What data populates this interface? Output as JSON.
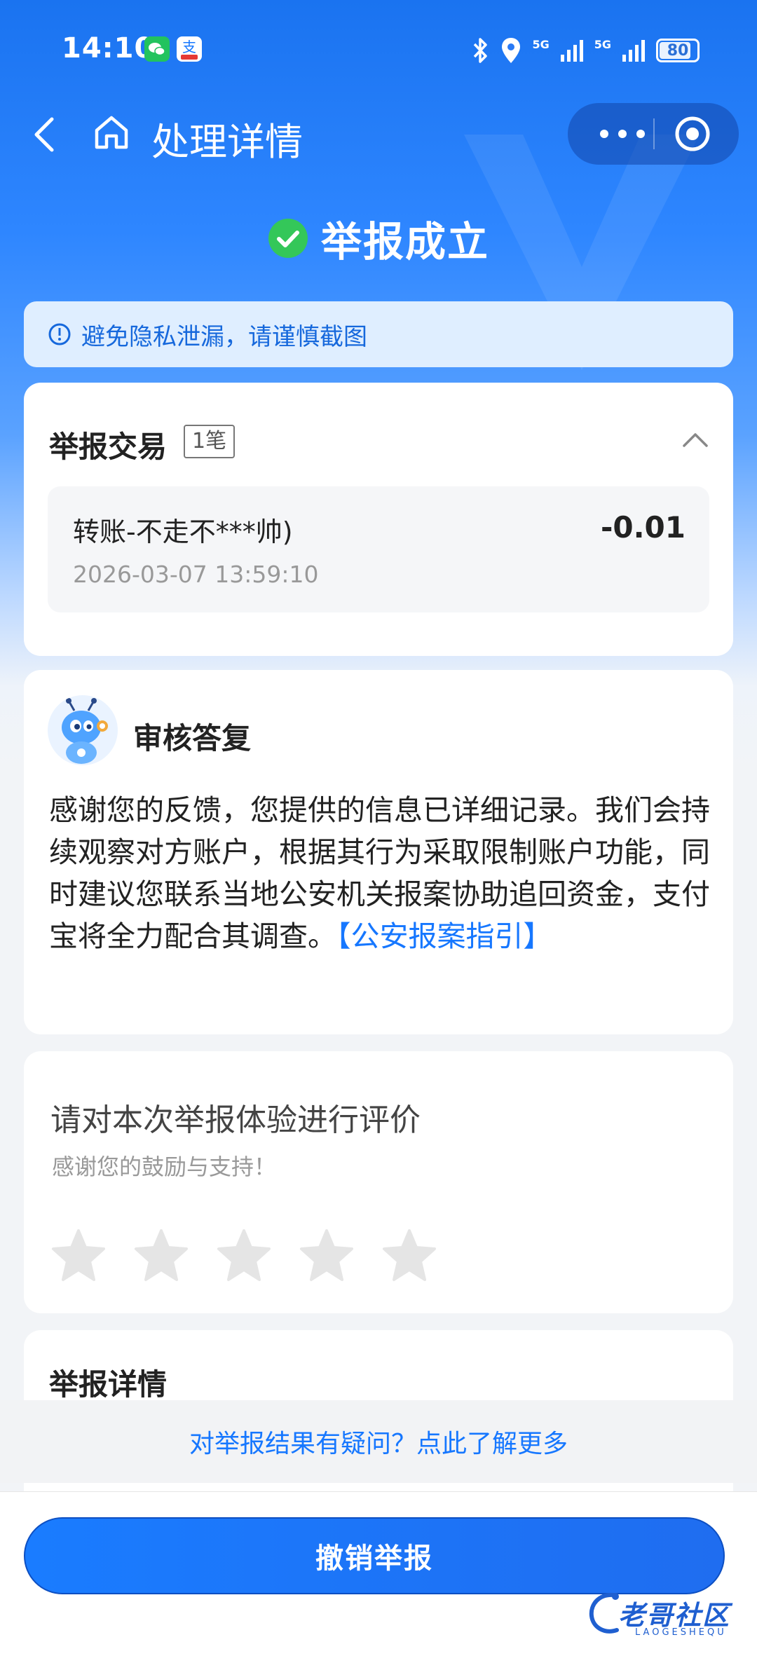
{
  "status_bar": {
    "time": "14:10",
    "network_labels": [
      "5G",
      "5G"
    ],
    "battery_level": "80"
  },
  "nav": {
    "title": "处理详情"
  },
  "result": {
    "title": "举报成立",
    "status_color": "#34c759"
  },
  "notice": {
    "text": "避免隐私泄漏，请谨慎截图"
  },
  "transaction_card": {
    "title": "举报交易",
    "count_badge": "1笔",
    "items": [
      {
        "name": "转账-不走不***帅)",
        "time": "2026-03-07 13:59:10",
        "amount": "-0.01"
      }
    ]
  },
  "reply_card": {
    "title": "审核答复",
    "text": "感谢您的反馈，您提供的信息已详细记录。我们会持续观察对方账户，根据其行为采取限制账户功能，同时建议您联系当地公安机关报案协助追回资金，支付宝将全力配合其调查。",
    "link": "【公安报案指引】"
  },
  "rating_card": {
    "title": "请对本次举报体验进行评价",
    "subtitle": "感谢您的鼓励与支持！",
    "rating": 0,
    "max_rating": 5
  },
  "details_card": {
    "title": "举报详情"
  },
  "faq": {
    "link_text": "对举报结果有疑问？点此了解更多"
  },
  "bottom": {
    "revoke_label": "撤销举报"
  },
  "watermark": {
    "text": "老哥社区",
    "sub": "LAOGESHEQU"
  },
  "colors": {
    "brand_blue": "#1677ff",
    "header_blue": "#2e86ff",
    "success_green": "#34c759"
  }
}
